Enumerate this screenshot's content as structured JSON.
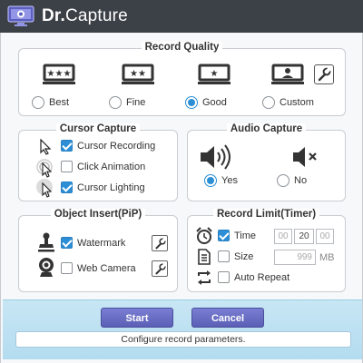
{
  "app": {
    "title_prefix": "Dr.",
    "title_suffix": "Capture"
  },
  "record_quality": {
    "title": "Record Quality",
    "options": [
      {
        "label": "Best",
        "icon": "three-star-film-icon",
        "selected": false
      },
      {
        "label": "Fine",
        "icon": "two-star-film-icon",
        "selected": false
      },
      {
        "label": "Good",
        "icon": "one-star-film-icon",
        "selected": true
      },
      {
        "label": "Custom",
        "icon": "custom-film-icon",
        "selected": false
      }
    ]
  },
  "cursor_capture": {
    "title": "Cursor Capture",
    "items": [
      {
        "label": "Cursor Recording",
        "icon": "cursor-icon",
        "checked": true
      },
      {
        "label": "Click Animation",
        "icon": "click-animation-icon",
        "checked": false
      },
      {
        "label": "Cursor Lighting",
        "icon": "cursor-lighting-icon",
        "checked": true
      }
    ]
  },
  "audio_capture": {
    "title": "Audio Capture",
    "yes_label": "Yes",
    "no_label": "No",
    "selected": "Yes"
  },
  "object_insert": {
    "title": "Object Insert(PiP)",
    "items": [
      {
        "label": "Watermark",
        "icon": "stamp-icon",
        "checked": true
      },
      {
        "label": "Web Camera",
        "icon": "webcam-icon",
        "checked": false
      }
    ]
  },
  "record_limit": {
    "title": "Record Limit(Timer)",
    "time_label": "Time",
    "time_checked": true,
    "hours": "00",
    "minutes": "20",
    "seconds": "00",
    "size_label": "Size",
    "size_checked": false,
    "size_value": "999",
    "size_unit": "MB",
    "repeat_label": "Auto Repeat",
    "repeat_checked": false
  },
  "buttons": {
    "start_label": "Start",
    "cancel_label": "Cancel"
  },
  "status_text": "Configure record parameters.",
  "colors": {
    "titlebar": "#3c4047",
    "accent": "#2c8fd6",
    "button": "#6a6ec7",
    "band": "#b9dff2"
  }
}
